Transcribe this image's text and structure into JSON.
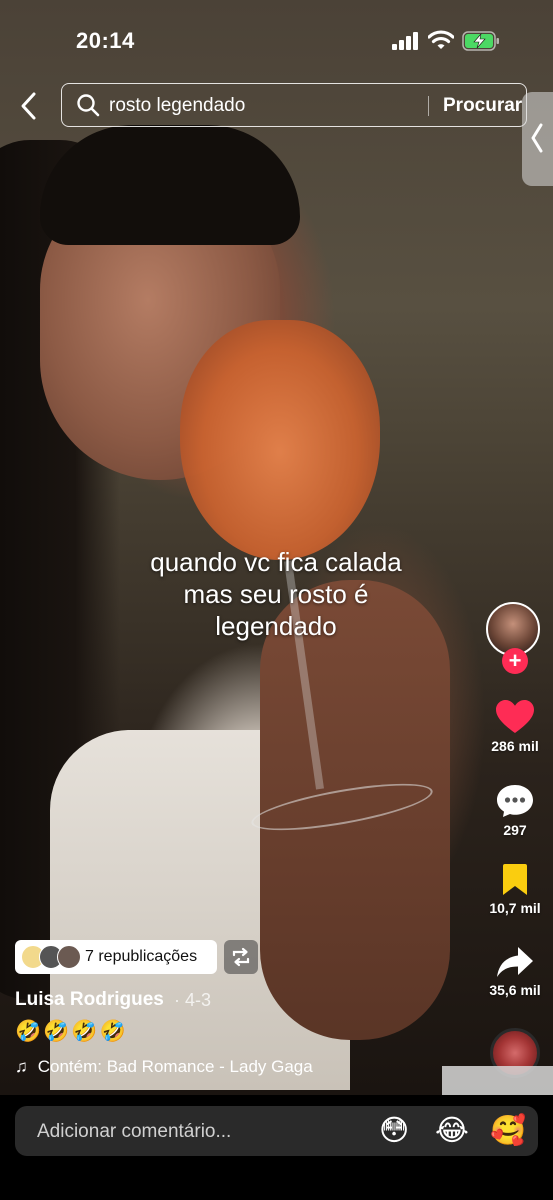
{
  "status_bar": {
    "time": "20:14",
    "signal_icon": "signal-bars-icon",
    "wifi_icon": "wifi-icon",
    "battery_icon": "battery-charging-icon"
  },
  "search": {
    "query": "rosto legendado",
    "submit_label": "Procurar",
    "back_icon": "chevron-left-icon",
    "search_icon": "magnifier-icon"
  },
  "video": {
    "caption_lines": [
      "quando vc fica calada",
      "mas seu rosto é",
      "legendado"
    ]
  },
  "actions": {
    "like_count": "286 mil",
    "comment_count": "297",
    "save_count": "10,7 mil",
    "share_count": "35,6 mil",
    "follow_symbol": "+"
  },
  "info": {
    "reposts_label": "7 republicações",
    "author": "Luisa Rodrigues",
    "date": "· 4-3",
    "description": "🤣🤣🤣🤣",
    "sound_note": "♫",
    "sound": "Contém: Bad Romance - Lady Gaga"
  },
  "comment_bar": {
    "placeholder": "Adicionar comentário...",
    "emojis": [
      "😳",
      "😂",
      "🥰"
    ]
  },
  "colors": {
    "like": "#fe2c55",
    "save": "#facd0f",
    "follow": "#fe2c55"
  }
}
